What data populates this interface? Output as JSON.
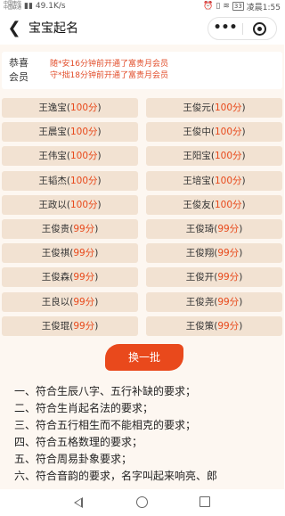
{
  "status_bar": {
    "carrier_top": "中国电信",
    "carrier_bottom": "中国联通",
    "network": "49.1K/s",
    "battery": "33",
    "time": "凌晨1:55"
  },
  "nav": {
    "back_icon": "chevron-left-icon",
    "title": "宝宝起名",
    "more_icon": "more-dots-icon",
    "close_icon": "target-circle-icon"
  },
  "congrats": {
    "label_line1": "恭喜",
    "label_line2": "会员",
    "lines": [
      "随*安16分钟前开通了富贵月会员",
      "守*拙18分钟前开通了富贵月会员"
    ]
  },
  "names": [
    {
      "name": "王逸宝",
      "score": "100分"
    },
    {
      "name": "王俊元",
      "score": "100分"
    },
    {
      "name": "王晨宝",
      "score": "100分"
    },
    {
      "name": "王俊中",
      "score": "100分"
    },
    {
      "name": "王伟宝",
      "score": "100分"
    },
    {
      "name": "王阳宝",
      "score": "100分"
    },
    {
      "name": "王韬杰",
      "score": "100分"
    },
    {
      "name": "王培宝",
      "score": "100分"
    },
    {
      "name": "王政以",
      "score": "100分"
    },
    {
      "name": "王俊友",
      "score": "100分"
    },
    {
      "name": "王俊贵",
      "score": "99分"
    },
    {
      "name": "王俊琦",
      "score": "99分"
    },
    {
      "name": "王俊祺",
      "score": "99分"
    },
    {
      "name": "王俊翔",
      "score": "99分"
    },
    {
      "name": "王俊森",
      "score": "99分"
    },
    {
      "name": "王俊开",
      "score": "99分"
    },
    {
      "name": "王良以",
      "score": "99分"
    },
    {
      "name": "王俊尧",
      "score": "99分"
    },
    {
      "name": "王俊琨",
      "score": "99分"
    },
    {
      "name": "王俊策",
      "score": "99分"
    }
  ],
  "refresh_label": "换一批",
  "requirements": [
    "一、符合生辰八字、五行补缺的要求；",
    "二、符合生肖起名法的要求；",
    "三、符合五行相生而不能相克的要求；",
    "四、符合五格数理的要求；",
    "五、符合周易卦象要求；",
    "六、符合音韵的要求，名字叫起来响亮、郎"
  ],
  "colors": {
    "accent": "#e9491c",
    "score": "#e8491b",
    "cell_bg": "#f2e2d2",
    "page_bg": "#fdf7f1"
  }
}
